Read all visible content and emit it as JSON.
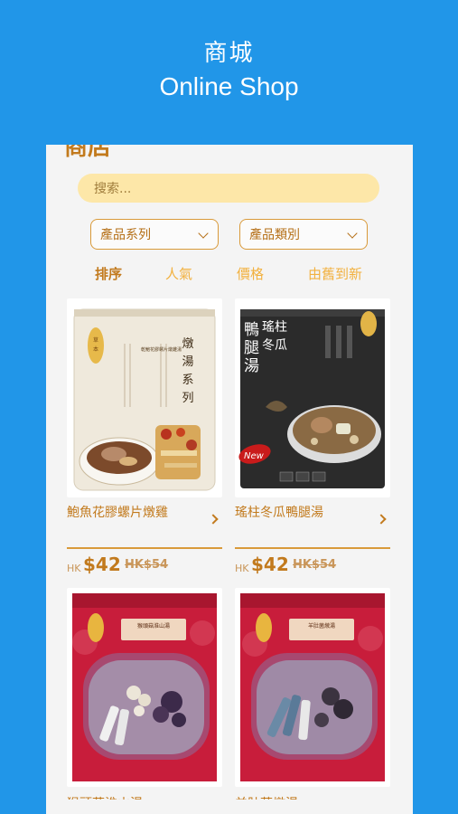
{
  "promo": {
    "title_zh": "商城",
    "title_en": "Online Shop"
  },
  "header": {
    "title": "商店"
  },
  "search": {
    "placeholder": "搜索..."
  },
  "filters": {
    "series_label": "產品系列",
    "category_label": "產品類別"
  },
  "sort": {
    "label": "排序",
    "options": [
      "人氣",
      "價格",
      "由舊到新"
    ]
  },
  "products": [
    {
      "name": "鮑魚花膠螺片燉雞",
      "currency": "HK",
      "price": "$42",
      "old_price": "HK$54",
      "pack_text_vertical": "燉湯系列",
      "pack_subtitle": "乾鮑花膠螺片燉雞湯"
    },
    {
      "name": "瑤柱冬瓜鴨腿湯",
      "currency": "HK",
      "price": "$42",
      "old_price": "HK$54",
      "pack_title_a": "鴨腿湯",
      "pack_title_b": "瑤柱冬瓜",
      "pack_badge": "New"
    },
    {
      "name": "猴頭菇淮山湯",
      "pack_label": "猴頭菇淮山湯"
    },
    {
      "name": "羊肚菌燉湯",
      "pack_label": "羊肚菌燉湯"
    }
  ],
  "colors": {
    "background": "#2196e8",
    "accent": "#c27a1d",
    "search_bg": "#fde7a8"
  }
}
